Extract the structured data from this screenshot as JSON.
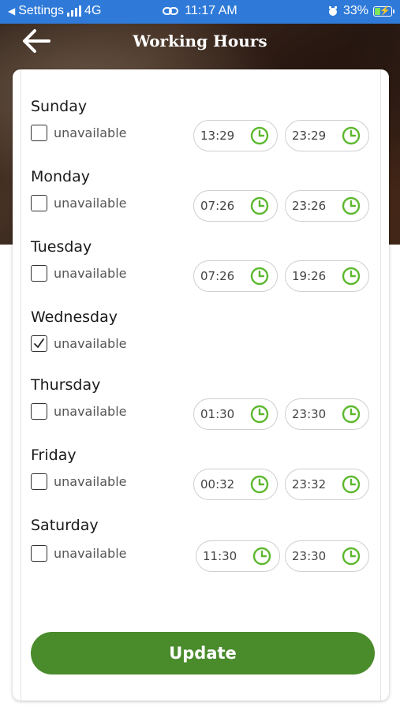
{
  "status_bar": {
    "back_app": "Settings",
    "network": "4G",
    "time": "11:17 AM",
    "battery": "33%"
  },
  "header": {
    "title": "Working Hours"
  },
  "unavailable_label": "unavailable",
  "days": [
    {
      "name": "Sunday",
      "unavailable": false,
      "start": "13:29",
      "end": "23:29"
    },
    {
      "name": "Monday",
      "unavailable": false,
      "start": "07:26",
      "end": "23:26"
    },
    {
      "name": "Tuesday",
      "unavailable": false,
      "start": "07:26",
      "end": "19:26"
    },
    {
      "name": "Wednesday",
      "unavailable": true,
      "start": "",
      "end": ""
    },
    {
      "name": "Thursday",
      "unavailable": false,
      "start": "01:30",
      "end": "23:30"
    },
    {
      "name": "Friday",
      "unavailable": false,
      "start": "00:32",
      "end": "23:32"
    },
    {
      "name": "Saturday",
      "unavailable": false,
      "start": "11:30",
      "end": "23:30"
    }
  ],
  "update_label": "Update",
  "colors": {
    "accent_green": "#4a8b2c",
    "clock_green": "#5cb82e",
    "status_blue": "#2f7ad8"
  }
}
